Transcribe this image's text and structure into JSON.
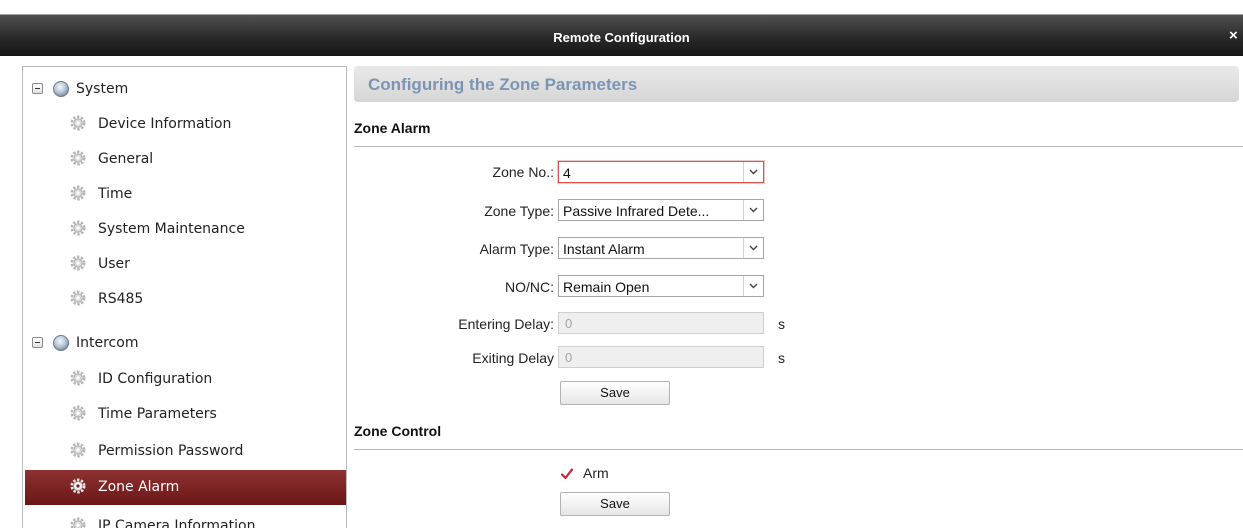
{
  "window": {
    "title": "Remote Configuration",
    "close_glyph": "×"
  },
  "tree": {
    "groups": [
      {
        "label": "System",
        "icon": "globe-icon"
      },
      {
        "label": "Intercom",
        "icon": "globe-icon"
      }
    ],
    "system_items": [
      {
        "label": "Device Information"
      },
      {
        "label": "General"
      },
      {
        "label": "Time"
      },
      {
        "label": "System Maintenance"
      },
      {
        "label": "User"
      },
      {
        "label": "RS485"
      }
    ],
    "intercom_items": [
      {
        "label": "ID Configuration"
      },
      {
        "label": "Time Parameters"
      },
      {
        "label": "Permission Password"
      },
      {
        "label": "Zone Alarm",
        "selected": true
      },
      {
        "label": "IP Camera Information"
      }
    ]
  },
  "main": {
    "title": "Configuring the Zone Parameters",
    "zone_alarm": {
      "section_title": "Zone Alarm",
      "zone_no": {
        "label": "Zone No.:",
        "value": "4"
      },
      "zone_type": {
        "label": "Zone Type:",
        "value": "Passive Infrared Dete..."
      },
      "alarm_type": {
        "label": "Alarm Type:",
        "value": "Instant Alarm"
      },
      "no_nc": {
        "label": "NO/NC:",
        "value": "Remain Open"
      },
      "entering_delay": {
        "label": "Entering Delay:",
        "value": "0",
        "unit": "s"
      },
      "exiting_delay": {
        "label": "Exiting Delay",
        "value": "0",
        "unit": "s"
      },
      "save_label": "Save"
    },
    "zone_control": {
      "section_title": "Zone Control",
      "arm_label": "Arm",
      "arm_checked": true,
      "save_label": "Save"
    }
  },
  "colors": {
    "selected_item": "#7a2222",
    "page_title": "#7c95b5",
    "focus_border": "#d9534f",
    "check_mark": "#c0282d"
  }
}
